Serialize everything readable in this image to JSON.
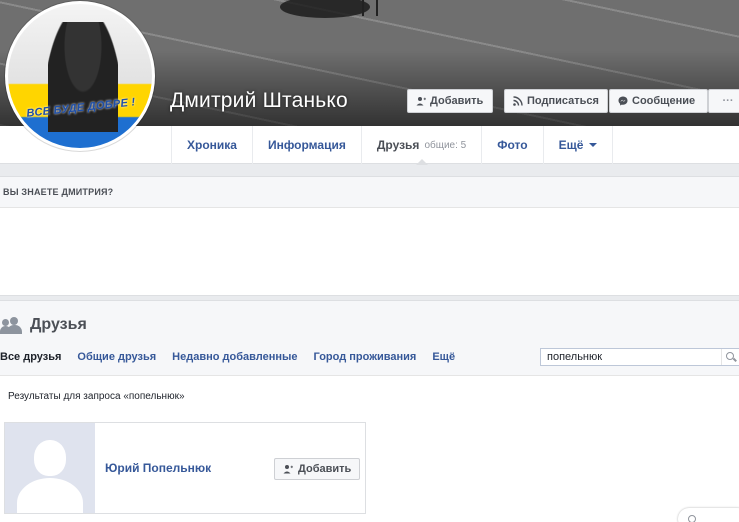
{
  "profile": {
    "name": "Дмитрий Штанько",
    "avatar_text": "ВСЕ БУДЕ ДОБРЕ !"
  },
  "cover_actions": {
    "add_label": "Добавить",
    "subscribe_label": "Подписаться",
    "message_label": "Сообщение",
    "more_label": "···"
  },
  "tabs": [
    {
      "label": "Хроника"
    },
    {
      "label": "Информация"
    },
    {
      "label": "Друзья",
      "sub": "общие: 5"
    },
    {
      "label": "Фото"
    },
    {
      "label": "Ещё"
    }
  ],
  "know": {
    "title": "ВЫ ЗНАЕТЕ ДМИТРИЯ?"
  },
  "friends": {
    "title": "Друзья",
    "tabs": [
      "Все друзья",
      "Общие друзья",
      "Недавно добавленные",
      "Город проживания",
      "Ещё"
    ],
    "search_value": "попельнюк",
    "result_text": "Результаты для запроса «попельнюк»",
    "results": [
      {
        "name": "Юрий Попельнюк",
        "button": "Добавить"
      }
    ]
  },
  "colors": {
    "link": "#365899",
    "border": "#dddfe2",
    "bg": "#e9ebee"
  }
}
